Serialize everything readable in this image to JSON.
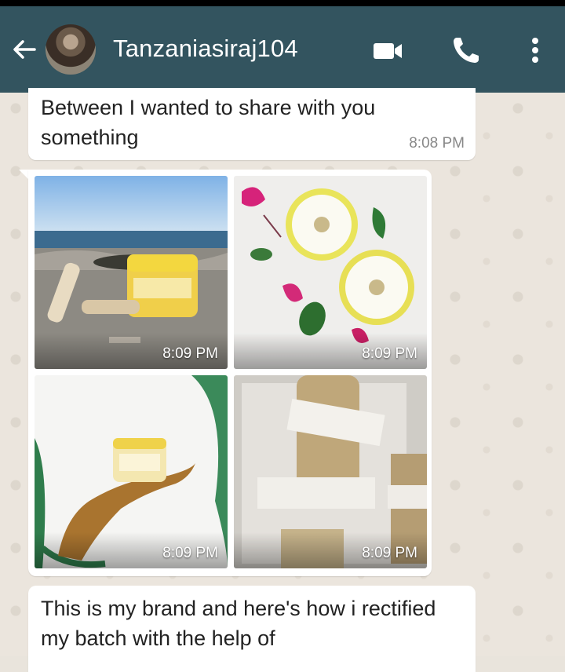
{
  "header": {
    "contact_name": "Tanzaniasiraj104",
    "icons": [
      "back-arrow-icon",
      "video-call-icon",
      "phone-icon",
      "more-vert-icon"
    ],
    "color": "#33545f"
  },
  "messages": {
    "first": {
      "text": "Between I wanted to share with you something",
      "time": "8:08 PM"
    },
    "media": [
      {
        "time": "8:09 PM",
        "subject": "beach-product"
      },
      {
        "time": "8:09 PM",
        "subject": "jars-flowers"
      },
      {
        "time": "8:09 PM",
        "subject": "hand-jar"
      },
      {
        "time": "8:09 PM",
        "subject": "packaged-bottles"
      }
    ],
    "last": {
      "text": "This is my brand and here's how i rectified my batch with the help of"
    }
  }
}
